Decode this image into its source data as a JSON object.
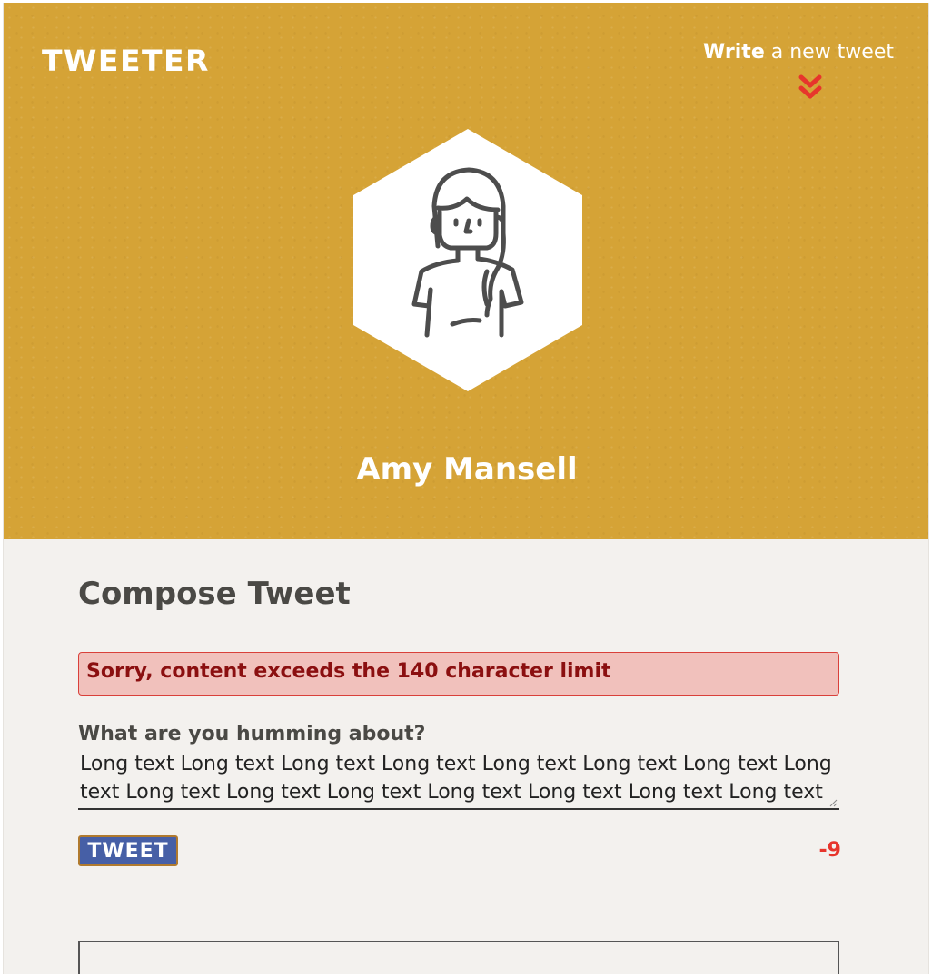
{
  "header": {
    "logo": "TWEETER",
    "write_link_bold": "Write",
    "write_link_rest": " a new tweet",
    "chevron_icon": "double-chevron-down-icon",
    "chevron_color": "#e7352c",
    "background_color": "#d5a336"
  },
  "profile": {
    "avatar_icon": "woman-avatar-icon",
    "name": "Amy Mansell"
  },
  "compose": {
    "title": "Compose Tweet",
    "error_message": "Sorry, content exceeds the 140 character limit",
    "field_label": "What are you humming about?",
    "text_value": "Long text Long text Long text Long text Long text Long text Long text Long text Long text Long text Long text Long text Long text Long text Long text",
    "tweet_button": "TWEET",
    "char_counter": "-9"
  },
  "colors": {
    "error_text": "#8b0f10",
    "error_bg": "#f1c1bc",
    "button_bg": "#465fa6",
    "counter": "#e7352c"
  }
}
